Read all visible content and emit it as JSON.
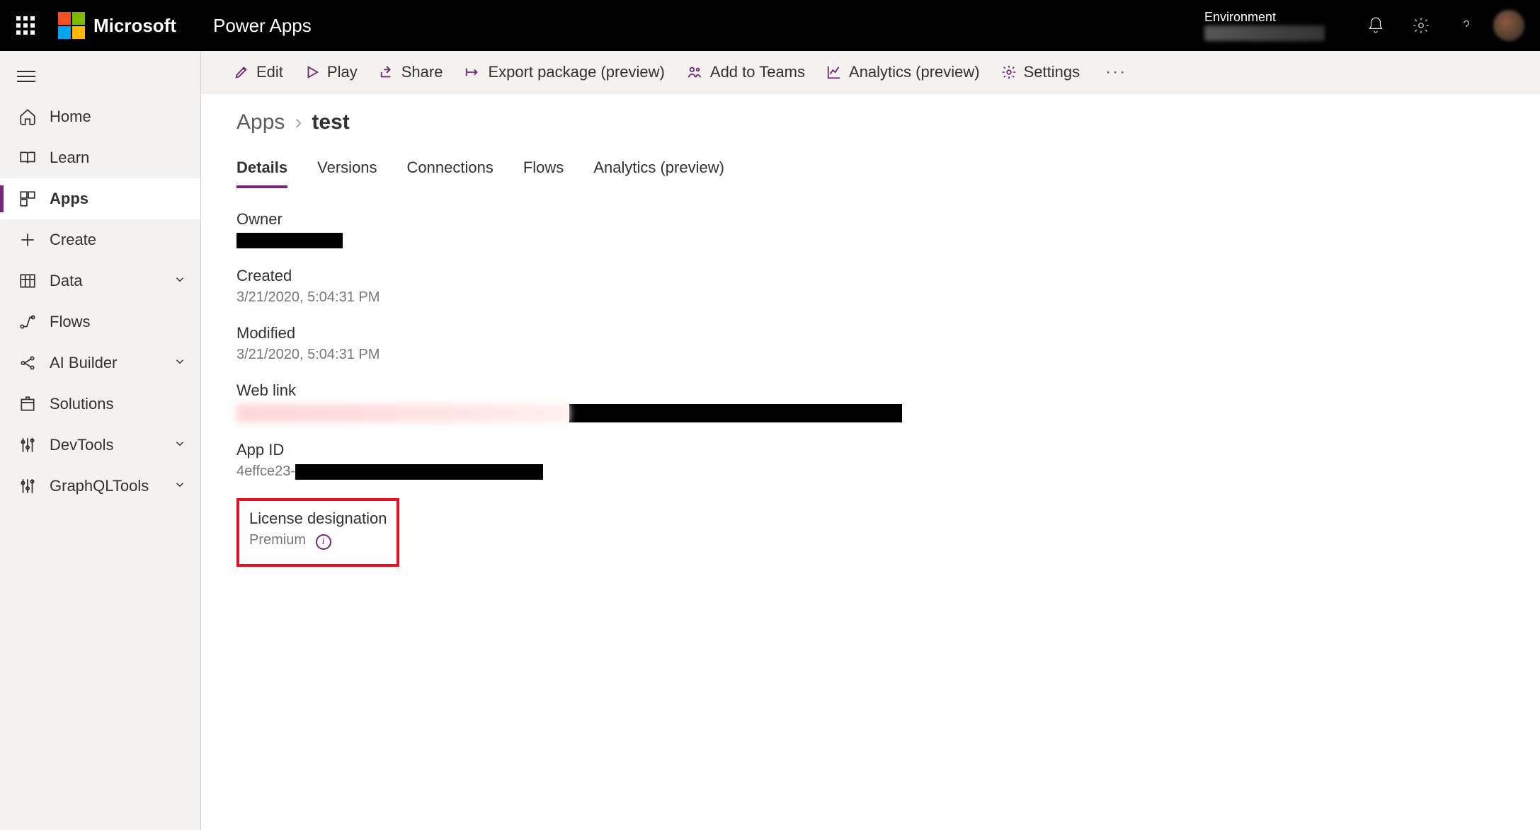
{
  "header": {
    "brand": "Microsoft",
    "app_title": "Power Apps",
    "environment_label": "Environment"
  },
  "sidebar": {
    "items": [
      {
        "label": "Home"
      },
      {
        "label": "Learn"
      },
      {
        "label": "Apps"
      },
      {
        "label": "Create"
      },
      {
        "label": "Data"
      },
      {
        "label": "Flows"
      },
      {
        "label": "AI Builder"
      },
      {
        "label": "Solutions"
      },
      {
        "label": "DevTools"
      },
      {
        "label": "GraphQLTools"
      }
    ]
  },
  "commands": {
    "edit": "Edit",
    "play": "Play",
    "share": "Share",
    "export": "Export package (preview)",
    "teams": "Add to Teams",
    "analytics": "Analytics (preview)",
    "settings": "Settings"
  },
  "breadcrumb": {
    "root": "Apps",
    "current": "test"
  },
  "tabs": {
    "details": "Details",
    "versions": "Versions",
    "connections": "Connections",
    "flows": "Flows",
    "analytics": "Analytics (preview)"
  },
  "details": {
    "owner_label": "Owner",
    "created_label": "Created",
    "created_value": "3/21/2020, 5:04:31 PM",
    "modified_label": "Modified",
    "modified_value": "3/21/2020, 5:04:31 PM",
    "weblink_label": "Web link",
    "appid_label": "App ID",
    "appid_prefix": "4effce23-",
    "license_label": "License designation",
    "license_value": "Premium"
  }
}
